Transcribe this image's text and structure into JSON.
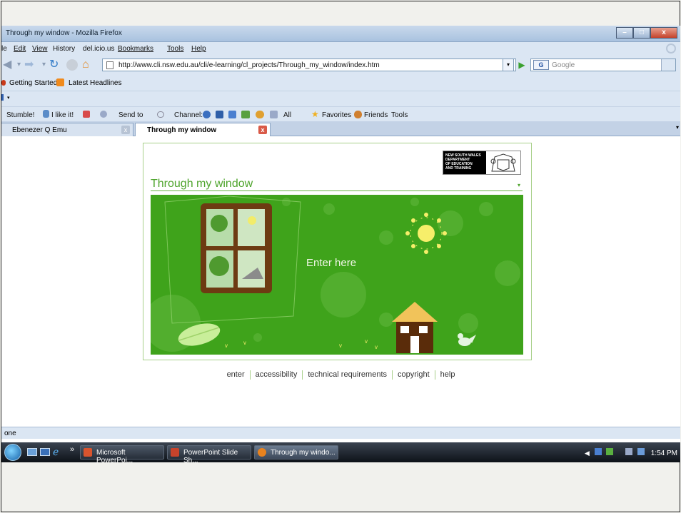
{
  "window": {
    "title": "Through my window - Mozilla Firefox",
    "controls": [
      "–",
      "□",
      "x"
    ]
  },
  "menu": [
    "le",
    "Edit",
    "View",
    "History",
    "del.icio.us",
    "Bookmarks",
    "Tools",
    "Help"
  ],
  "nav": {
    "url": "http://www.cli.nsw.edu.au/cli/e-learning/cl_projects/Through_my_window/index.htm",
    "search_placeholder": "Google",
    "search_engine": "G"
  },
  "bookmarks": [
    "Getting Started",
    "Latest Headlines"
  ],
  "stumble_bar": {
    "stumble": "Stumble!",
    "like": "I like it!",
    "send": "Send to",
    "channel": "Channel:",
    "all": "All",
    "favorites": "Favorites",
    "friends": "Friends",
    "tools": "Tools"
  },
  "tabs": [
    {
      "label": "Ebenezer Q Emu",
      "active": false
    },
    {
      "label": "Through my window",
      "active": true
    }
  ],
  "page": {
    "logo_lines": [
      "NEW SOUTH WALES",
      "DEPARTMENT",
      "OF EDUCATION",
      "AND TRAINING"
    ],
    "site_title": "Through  my window",
    "enter_text": "Enter here",
    "footer_links": [
      "enter",
      "accessibility",
      "technical requirements",
      "copyright",
      "help"
    ]
  },
  "status_text": "one",
  "taskbar": {
    "chevron": "»",
    "buttons": [
      {
        "label": "Microsoft PowerPoi...",
        "color": "#d9542e"
      },
      {
        "label": "PowerPoint Slide Sh...",
        "color": "#c8432b"
      },
      {
        "label": "Through my windo...",
        "color": "#e8821e"
      }
    ],
    "clock": "1:54 PM"
  },
  "colors": {
    "scene_green": "#3fa31b",
    "title_green": "#4ea42c",
    "frame_border": "#a8d08a"
  }
}
